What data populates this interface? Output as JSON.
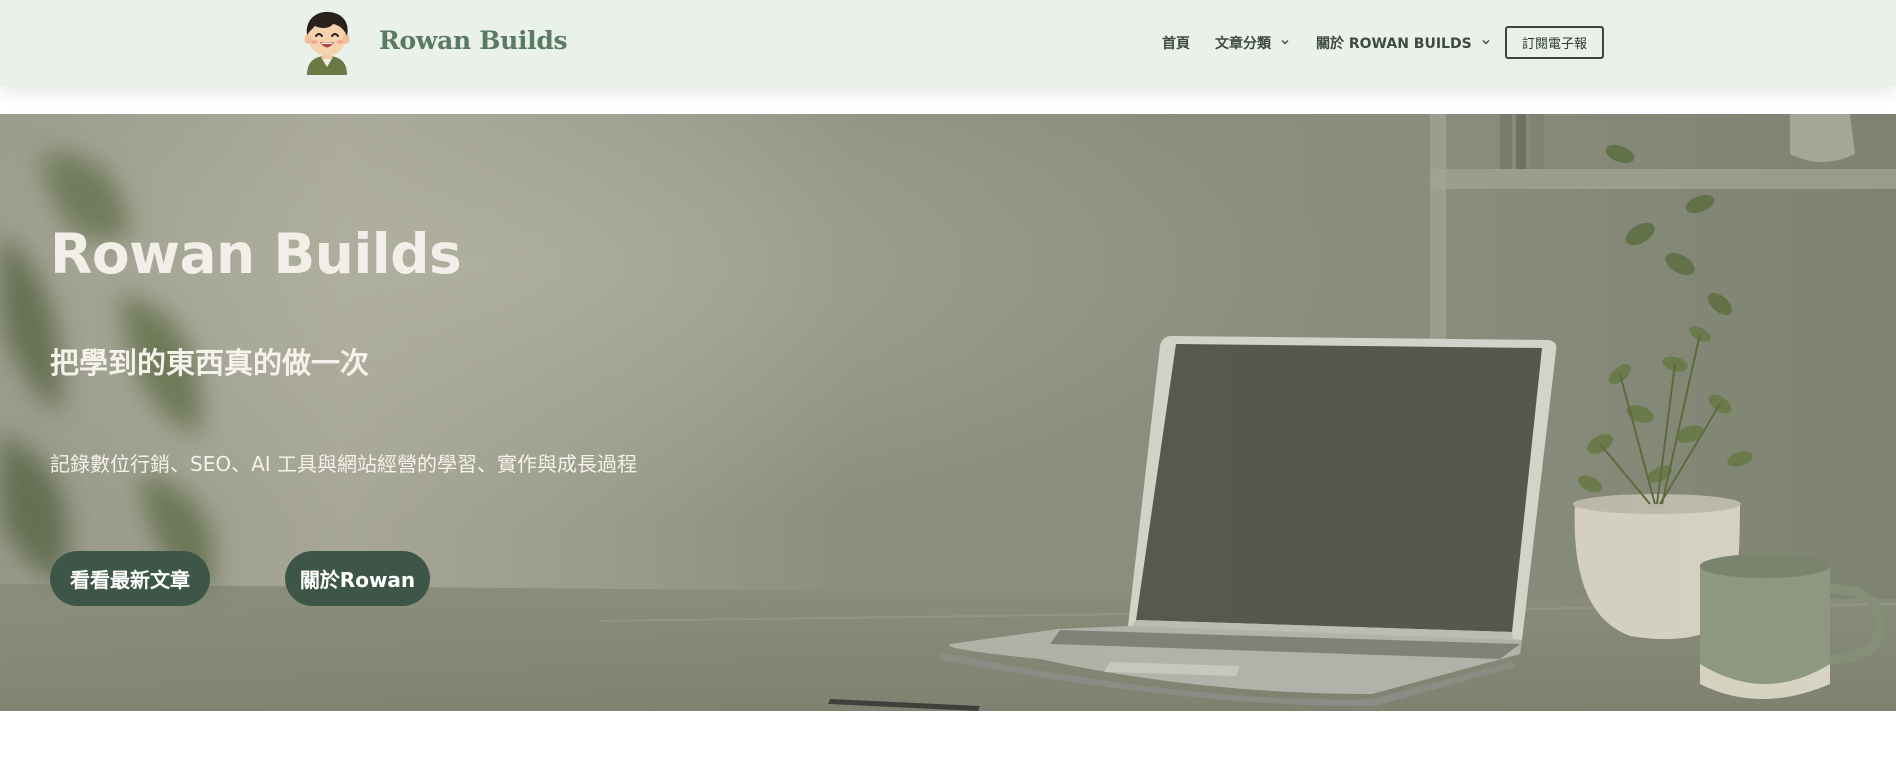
{
  "header": {
    "site_title": "Rowan Builds",
    "avatar_icon": "cartoon-avatar-icon",
    "nav": {
      "home": "首頁",
      "categories": "文章分類",
      "about": "關於 ROWAN BUILDS"
    },
    "subscribe_label": "訂閱電子報"
  },
  "hero": {
    "title": "Rowan Builds",
    "subtitle": "把學到的東西真的做一次",
    "description": "記錄數位行銷、SEO、AI 工具與網站經營的學習、實作與成長過程",
    "buttons": {
      "latest": "看看最新文章",
      "about": "關於Rowan"
    }
  },
  "colors": {
    "header_bg": "#e9f1ea",
    "brand_green": "#5b7a64",
    "button_bg": "#3e5648",
    "hero_bg": "#8f917f"
  }
}
